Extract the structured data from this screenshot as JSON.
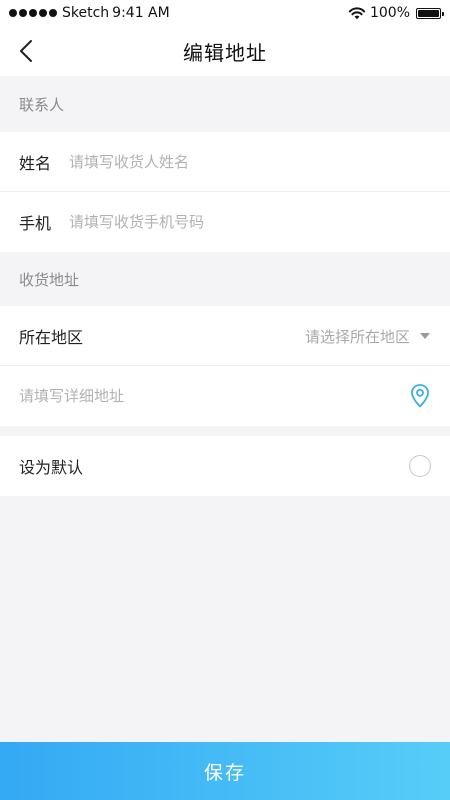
{
  "status_bar": {
    "carrier": "Sketch",
    "time": "9:41 AM",
    "battery_text": "100%",
    "battery_level": 1.0
  },
  "nav": {
    "title": "编辑地址",
    "back_icon": "chevron-left-icon"
  },
  "contact_section": {
    "header": "联系人",
    "name_label": "姓名",
    "name_placeholder": "请填写收货人姓名",
    "name_value": "",
    "phone_label": "手机",
    "phone_placeholder": "请填写收货手机号码",
    "phone_value": ""
  },
  "address_section": {
    "header": "收货地址",
    "region_label": "所在地区",
    "region_placeholder": "请选择所在地区",
    "detail_placeholder": "请填写详细地址",
    "detail_value": "",
    "location_icon": "location-pin-icon",
    "accent_color": "#3aaee8"
  },
  "default_setting": {
    "label": "设为默认",
    "checked": false
  },
  "save_button": {
    "label": "保存",
    "gradient_start": "#34a9f4",
    "gradient_end": "#56cdf8"
  }
}
